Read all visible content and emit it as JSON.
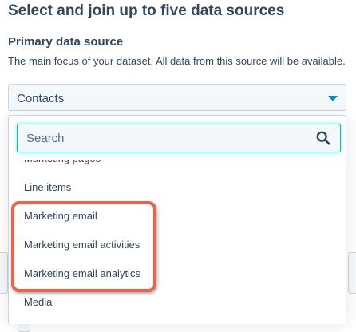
{
  "heading": "Select and join up to five data sources",
  "primary": {
    "label": "Primary data source",
    "description": "The main focus of your dataset. All data from this source will be available.",
    "selected_value": "Contacts"
  },
  "dropdown": {
    "search_placeholder": "Search",
    "search_value": "",
    "items": [
      "Marketing pages",
      "Line items",
      "Marketing email",
      "Marketing email activities",
      "Marketing email analytics",
      "Media"
    ]
  },
  "colors": {
    "accent": "#0091ae",
    "focus_border": "#00bda5",
    "text": "#33475b",
    "highlight_annotation": "#e2674f"
  }
}
